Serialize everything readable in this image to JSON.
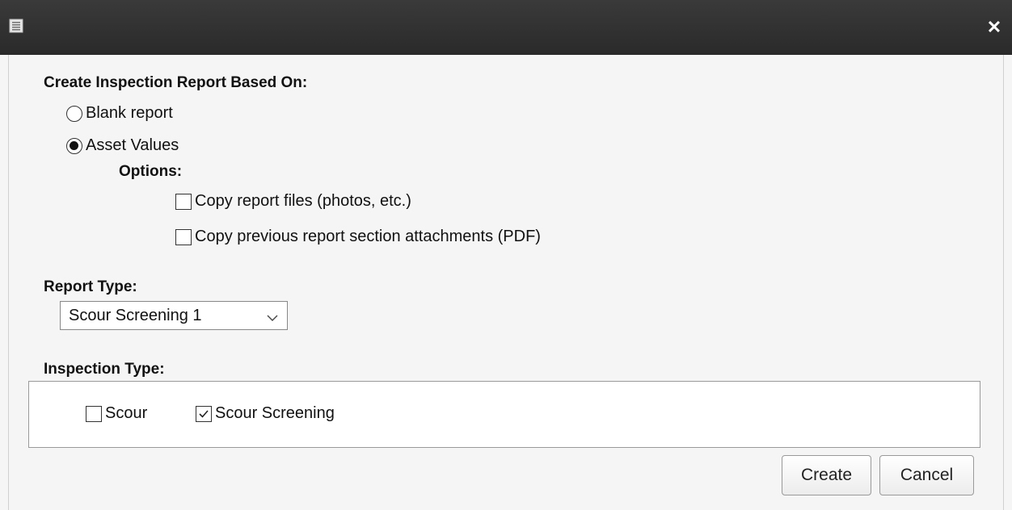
{
  "dialog": {
    "title": "",
    "title_icon": "document-list-icon",
    "close_icon": "close-icon",
    "close_glyph": "✕"
  },
  "report_source": {
    "heading": "Create Inspection Report Based On:",
    "options": [
      {
        "label": "Blank report",
        "selected": false
      },
      {
        "label": "Asset Values",
        "selected": true
      }
    ],
    "options_heading": "Options:",
    "checkboxes": [
      {
        "label": "Copy report files (photos, etc.)",
        "checked": false
      },
      {
        "label": "Copy previous report section attachments (PDF)",
        "checked": false
      }
    ]
  },
  "report_type": {
    "heading": "Report Type:",
    "selected": "Scour Screening 1"
  },
  "inspection_type": {
    "heading": "Inspection Type:",
    "options": [
      {
        "label": "Scour",
        "checked": false
      },
      {
        "label": "Scour Screening",
        "checked": true
      }
    ]
  },
  "actions": {
    "create_label": "Create",
    "cancel_label": "Cancel"
  }
}
